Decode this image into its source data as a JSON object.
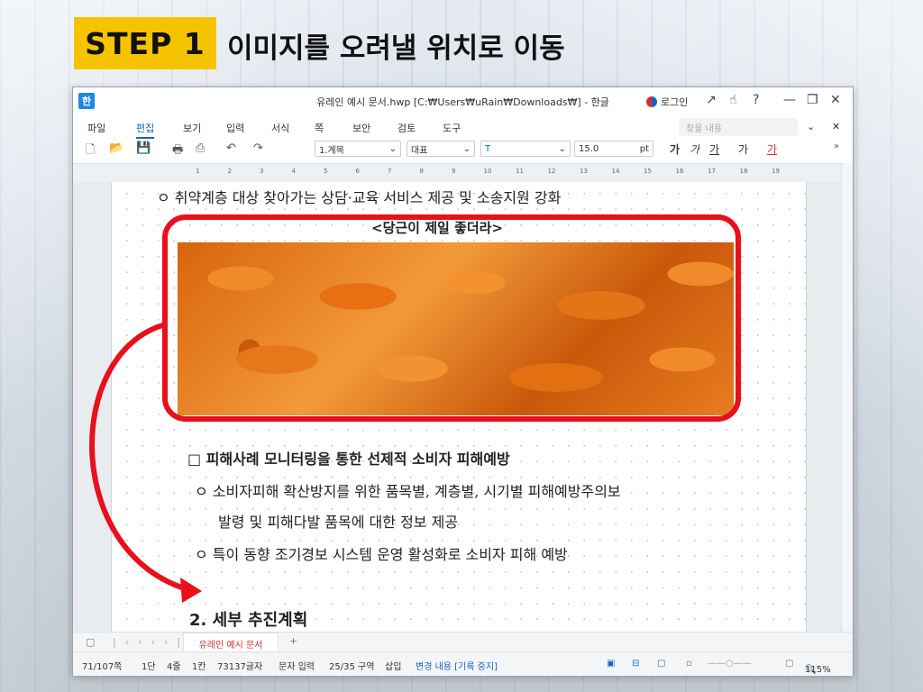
{
  "header": {
    "step_badge": "STEP 1",
    "step_title": "이미지를 오려낼 위치로 이동"
  },
  "window": {
    "app_icon": "한",
    "title": "유레인 예시 문서.hwp [C:₩Users₩uRain₩Downloads₩] - 한글",
    "login_label": "로그인",
    "controls": {
      "pin": "↗",
      "hand": "☝",
      "help": "?",
      "minimize": "—",
      "restore": "❐",
      "close": "✕"
    }
  },
  "menubar": {
    "items": [
      "파일",
      "편집",
      "보기",
      "입력",
      "서식",
      "쪽",
      "보안",
      "검토",
      "도구"
    ],
    "find_placeholder": "찾을 내용"
  },
  "toolbar": {
    "style_select": "1.계목",
    "font_select": "대표",
    "font_name_select": "",
    "font_size": "15.0",
    "font_unit": "pt",
    "format_buttons": [
      "가",
      "가",
      "가",
      "가",
      "가"
    ]
  },
  "ruler": {
    "ticks": [
      "1",
      "2",
      "3",
      "4",
      "5",
      "6",
      "7",
      "8",
      "9",
      "10",
      "11",
      "12",
      "13",
      "14",
      "15",
      "16",
      "17",
      "18",
      "19"
    ]
  },
  "document": {
    "line_top": "ㅇ 취약계층 대상 찾아가는 상담·교육 서비스 제공 및 소송지원 강화",
    "image_caption": "<당근이 제일 좋더라>",
    "section_heading": "□ 피해사례 모니터링을 통한 선제적 소비자 피해예방",
    "bullet1_line1": "ㅇ 소비자피해 확산방지를 위한 품목별, 계층별, 시기별 피해예방주의보",
    "bullet1_line2": "발령 및 피해다발 품목에 대한 정보 제공",
    "bullet2": "ㅇ 특이 동향 조기경보 시스템 운영 활성화로 소비자 피해 예방",
    "next_heading": "2. 세부 추진계획"
  },
  "tabbar": {
    "doc_tab": "유레인 예시 문서",
    "add_tab": "+"
  },
  "statusbar": {
    "page": "71/107쪽",
    "column": "1단",
    "line": "4줄",
    "col": "1칸",
    "chars": "73137글자",
    "mode": "문자 입력",
    "section": "25/35 구역",
    "insert": "삽입",
    "track_changes": "변경 내용 [기록 중지]",
    "zoom": "115%"
  },
  "colors": {
    "step_badge": "#f6c300",
    "highlight": "#e8101a",
    "accent": "#1565c0"
  }
}
